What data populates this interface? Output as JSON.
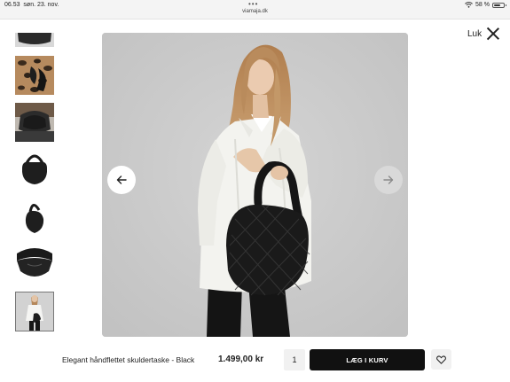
{
  "status_bar": {
    "time": "06.53",
    "date": "søn. 23. nov.",
    "dots": "•••",
    "url": "viamaja.dk",
    "battery": "58 %"
  },
  "close": {
    "label": "Luk",
    "icon": "close-icon"
  },
  "gallery": {
    "thumbnails": [
      {
        "name": "bag top crop",
        "icon": "bag-thumbnail"
      },
      {
        "name": "leopard print",
        "icon": "leopard-thumbnail"
      },
      {
        "name": "bag worn",
        "icon": "worn-bag-thumbnail"
      },
      {
        "name": "bag front",
        "icon": "bag-front-thumbnail"
      },
      {
        "name": "bag side",
        "icon": "bag-side-thumbnail"
      },
      {
        "name": "bag open",
        "icon": "bag-open-thumbnail"
      },
      {
        "name": "model",
        "icon": "model-thumbnail"
      }
    ],
    "selected_index": 6,
    "prev_icon": "arrow-left-icon",
    "next_icon": "arrow-right-icon"
  },
  "product": {
    "name": "Elegant håndflettet skuldertaske - Black",
    "price": "1.499,00 kr",
    "quantity": "1",
    "add_to_cart": "LÆG I KURV",
    "wishlist_icon": "heart-icon"
  },
  "colors": {
    "button_dark": "#111111",
    "panel_gray": "#d9d9d9"
  }
}
